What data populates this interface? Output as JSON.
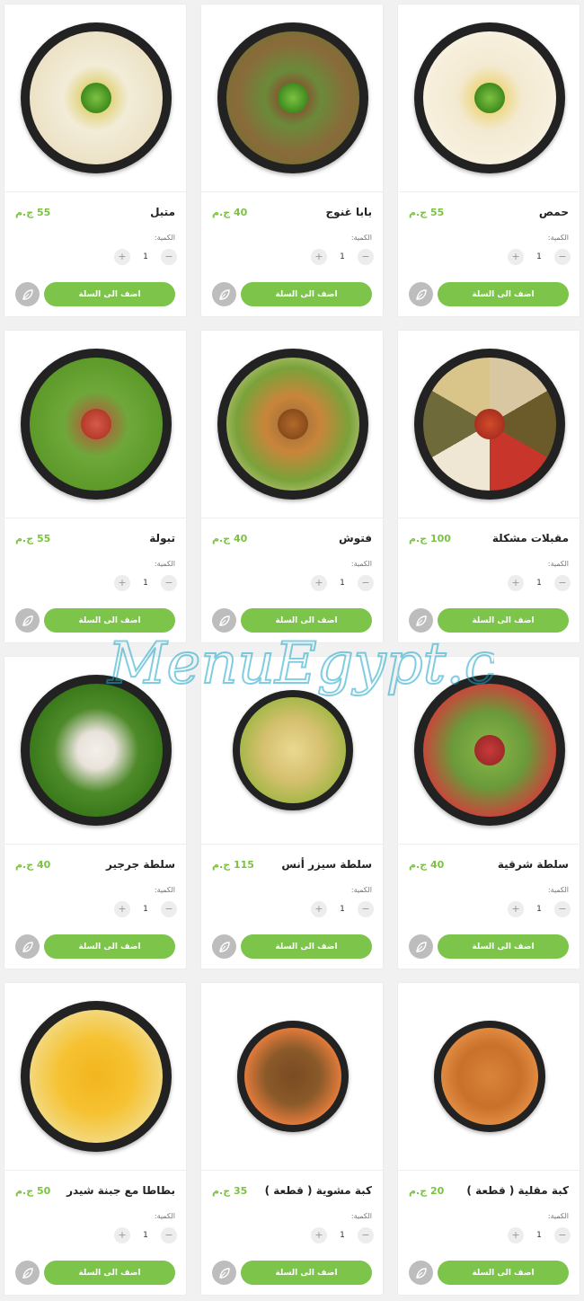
{
  "labels": {
    "quantity": "الكمية:",
    "add_to_cart": "اضف الى السلة",
    "currency_suffix": "ج.م"
  },
  "watermark_text": "MenuEgypt.com",
  "items": [
    {
      "name": "حمص",
      "price": "55 ج.م",
      "qty": "1",
      "food": "hummus"
    },
    {
      "name": "بابا غنوج",
      "price": "40 ج.م",
      "qty": "1",
      "food": "baba-ganoush"
    },
    {
      "name": "متبل",
      "price": "55 ج.م",
      "qty": "1",
      "food": "mutabal"
    },
    {
      "name": "مقبلات مشكلة",
      "price": "100 ج.م",
      "qty": "1",
      "food": "mixed-appetizers"
    },
    {
      "name": "فتوش",
      "price": "40 ج.م",
      "qty": "1",
      "food": "fattoush"
    },
    {
      "name": "تبولة",
      "price": "55 ج.م",
      "qty": "1",
      "food": "tabbouleh"
    },
    {
      "name": "سلطة شرقية",
      "price": "40 ج.م",
      "qty": "1",
      "food": "oriental-salad"
    },
    {
      "name": "سلطة سيزر أنس",
      "price": "115 ج.م",
      "qty": "1",
      "food": "caesar-salad"
    },
    {
      "name": "سلطة جرجير",
      "price": "40 ج.م",
      "qty": "1",
      "food": "arugula-salad"
    },
    {
      "name": "كبة مقلية ( قطعة )",
      "price": "20 ج.م",
      "qty": "1",
      "food": "fried-kibbeh"
    },
    {
      "name": "كبة مشوية ( قطعة )",
      "price": "35 ج.م",
      "qty": "1",
      "food": "grilled-kibbeh"
    },
    {
      "name": "بطاطا مع جبنة شيدر",
      "price": "50 ج.م",
      "qty": "1",
      "food": "cheddar-fries"
    }
  ],
  "colors": {
    "accent": "#7cc44a",
    "price": "#7cc242",
    "fav": "#bdbdbd"
  }
}
